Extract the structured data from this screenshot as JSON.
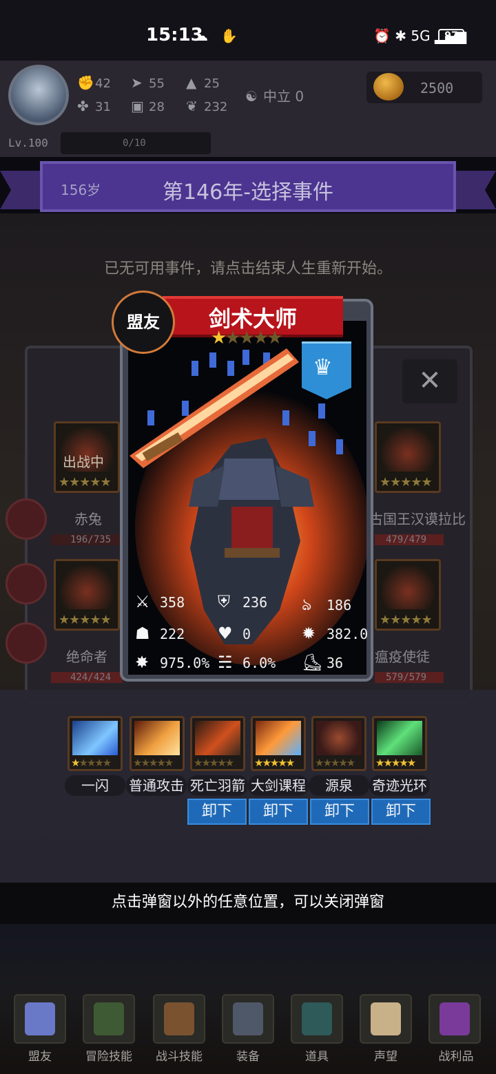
{
  "status_bar": {
    "time": "15:13",
    "left_icons": "☁ ✋",
    "right_icons": "⏰ ✱ 5G ▂▄▆",
    "battery": "97"
  },
  "header": {
    "stats": [
      {
        "icon": "fist-icon",
        "glyph": "✊",
        "value": "42"
      },
      {
        "icon": "boot-icon",
        "glyph": "➤",
        "value": "55"
      },
      {
        "icon": "witch-hat-icon",
        "glyph": "▲",
        "value": "25"
      },
      {
        "icon": "clover-icon",
        "glyph": "✤",
        "value": "31"
      },
      {
        "icon": "armor-icon",
        "glyph": "▣",
        "value": "28"
      },
      {
        "icon": "leaf-icon",
        "glyph": "❦",
        "value": "232"
      }
    ],
    "alignment": "中立 0",
    "gold": "2500",
    "level": "Lv.100",
    "exp": "0/10"
  },
  "banner": {
    "age": "156岁",
    "title": "第146年-选择事件"
  },
  "event_notice": "已无可用事件，请点击结束人生重新开始。",
  "team": {
    "members": [
      {
        "name": "赤兔",
        "hp": "196/735",
        "tag": "出战中",
        "stars": "★★★★★"
      },
      {
        "name": "古国王汉谟拉比",
        "hp": "479/479",
        "stars": "★★★★★"
      },
      {
        "name": "绝命者",
        "hp": "424/424",
        "stars": "★★★★★"
      },
      {
        "name": "瘟疫使徒",
        "hp": "579/579",
        "stars": "★★★★★"
      }
    ]
  },
  "card": {
    "badge": "盟友",
    "title": "剑术大师",
    "stars_filled": "★",
    "stars_empty": "★★★★",
    "class_icon": "crown-icon",
    "attributes": [
      {
        "icon": "sword-icon",
        "glyph": "⚔",
        "value": "358"
      },
      {
        "icon": "shield-icon",
        "glyph": "⛨",
        "value": "236"
      },
      {
        "icon": "speed-icon",
        "glyph": "ঌ",
        "value": "186"
      },
      {
        "icon": "hood-icon",
        "glyph": "☗",
        "value": "222"
      },
      {
        "icon": "heart-icon",
        "glyph": "♥",
        "value": "0"
      },
      {
        "icon": "burst-icon",
        "glyph": "✹",
        "value": "382.0"
      },
      {
        "icon": "crit-icon",
        "glyph": "✸",
        "value": "975.0%"
      },
      {
        "icon": "tornado-icon",
        "glyph": "☵",
        "value": "6.0%"
      },
      {
        "icon": "boot-icon",
        "glyph": "⛸",
        "value": "36"
      }
    ]
  },
  "skills": [
    {
      "name": "一闪",
      "stars_on": "★",
      "stars_off": "★★★★",
      "color": "#3a6fd8",
      "unload": ""
    },
    {
      "name": "普通攻击",
      "stars_on": "",
      "stars_off": "★★★★★",
      "color": "#d8742a",
      "unload": ""
    },
    {
      "name": "死亡羽箭",
      "stars_on": "",
      "stars_off": "★★★★★",
      "color": "#c4461e",
      "unload": "卸下"
    },
    {
      "name": "大剑课程",
      "stars_on": "★★★★★",
      "stars_off": "",
      "color": "#e0862a",
      "unload": "卸下"
    },
    {
      "name": "源泉",
      "stars_on": "",
      "stars_off": "★★★★★",
      "color": "#6a3a2a",
      "unload": "卸下"
    },
    {
      "name": "奇迹光环",
      "stars_on": "★★★★★",
      "stars_off": "",
      "color": "#3bb86a",
      "unload": "卸下"
    }
  ],
  "close_hint": "点击弹窗以外的任意位置，可以关闭弹窗",
  "nav": [
    {
      "label": "盟友",
      "icon": "ally-icon",
      "color": "#6a78c8"
    },
    {
      "label": "冒险技能",
      "icon": "book-icon",
      "color": "#3e5a34"
    },
    {
      "label": "战斗技能",
      "icon": "backpack-icon",
      "color": "#7a5230"
    },
    {
      "label": "装备",
      "icon": "crossed-swords-icon",
      "color": "#4e5868"
    },
    {
      "label": "道具",
      "icon": "bag-icon",
      "color": "#2e5a5a"
    },
    {
      "label": "声望",
      "icon": "scroll-icon",
      "color": "#c8b088"
    },
    {
      "label": "战利品",
      "icon": "chest-icon",
      "color": "#7a3a9a"
    }
  ]
}
